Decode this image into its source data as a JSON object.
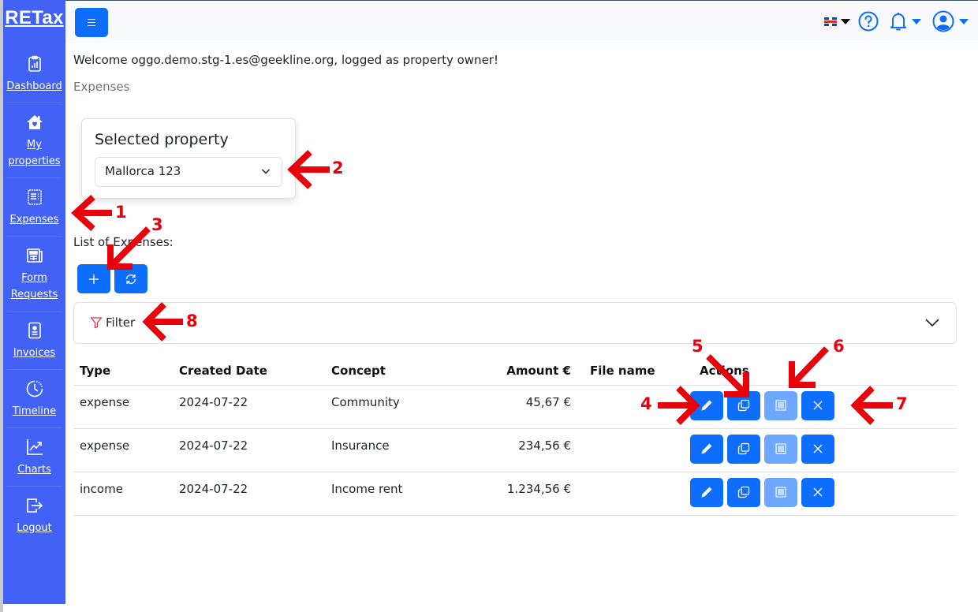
{
  "app": {
    "brand": "RETax"
  },
  "sidebar": {
    "items": [
      {
        "label": "Dashboard",
        "icon": "clipboard-chart-icon"
      },
      {
        "label": "My properties",
        "icon": "house-heart-icon"
      },
      {
        "label": "Expenses",
        "icon": "receipt-icon"
      },
      {
        "label": "Form Requests",
        "icon": "newspaper-icon"
      },
      {
        "label": "Invoices",
        "icon": "person-badge-icon"
      },
      {
        "label": "Timeline",
        "icon": "clock-history-icon"
      },
      {
        "label": "Charts",
        "icon": "graph-up-arrow-icon"
      },
      {
        "label": "Logout",
        "icon": "box-arrow-right-icon"
      }
    ]
  },
  "topbar": {
    "menu_icon": "hamburger-icon",
    "language_icon": "uk-flag-icon",
    "help_icon": "question-circle-icon",
    "notifications_icon": "bell-icon",
    "user_icon": "person-circle-icon"
  },
  "main": {
    "welcome": "Welcome oggo.demo.stg-1.es@geekline.org, logged as property owner!",
    "breadcrumb": "Expenses",
    "property_card": {
      "title": "Selected property",
      "selected": "Mallorca 123"
    },
    "list_label": "List of Expenses:",
    "filter_label": "Filter",
    "table": {
      "columns": [
        "Type",
        "Created Date",
        "Concept",
        "Amount €",
        "File name",
        "Actions"
      ],
      "rows": [
        {
          "type": "expense",
          "date": "2024-07-22",
          "concept": "Community",
          "amount": "45,67 €",
          "file": ""
        },
        {
          "type": "expense",
          "date": "2024-07-22",
          "concept": "Insurance",
          "amount": "234,56 €",
          "file": ""
        },
        {
          "type": "income",
          "date": "2024-07-22",
          "concept": "Income rent",
          "amount": "1.234,56 €",
          "file": ""
        }
      ]
    }
  },
  "annotations": [
    "1",
    "2",
    "3",
    "4",
    "5",
    "6",
    "7",
    "8"
  ],
  "colors": {
    "sidebar": "#4261f5",
    "primary": "#0d6efd",
    "primary_light": "#6ea8fe",
    "annotation": "#e8000b"
  }
}
